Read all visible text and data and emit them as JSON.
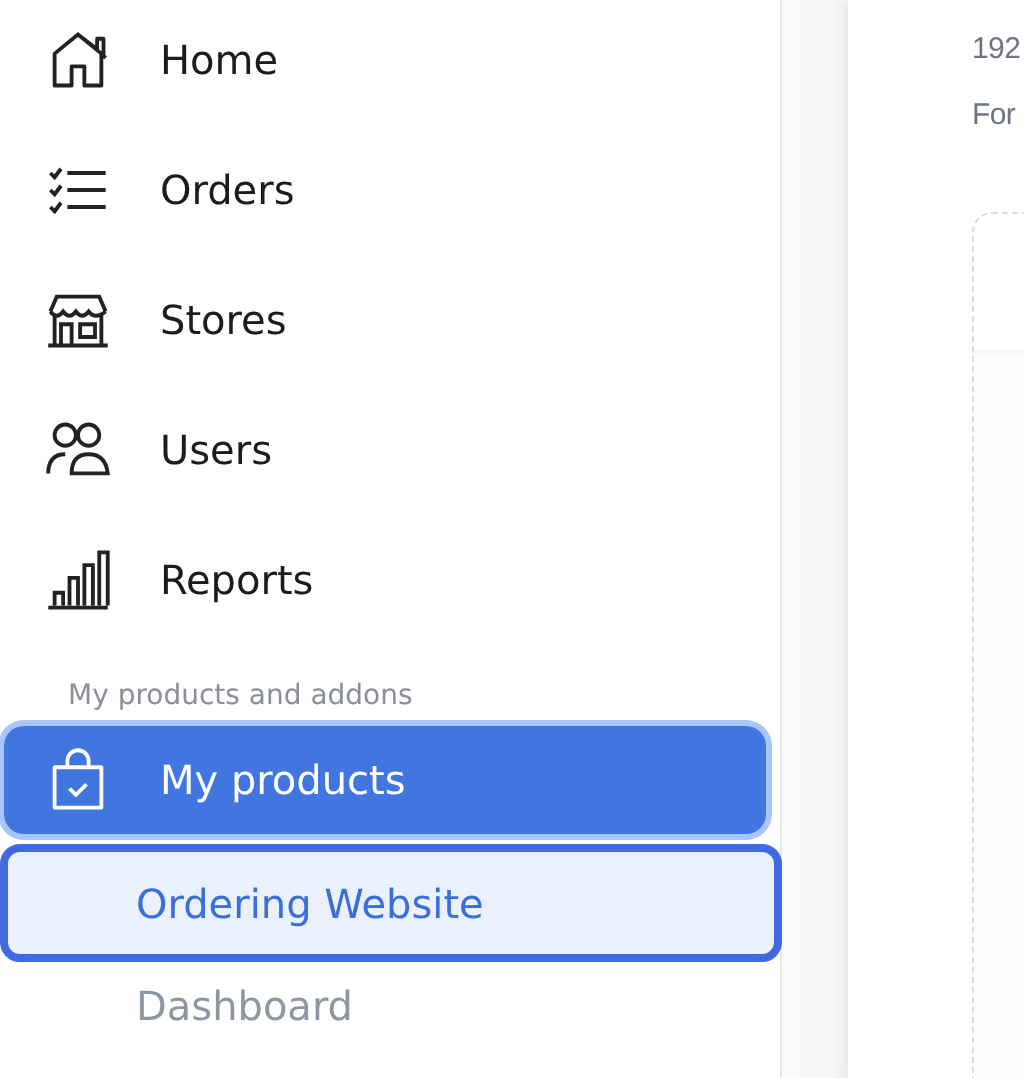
{
  "sidebar": {
    "items": [
      {
        "label": "Home",
        "selected": false
      },
      {
        "label": "Orders",
        "selected": false
      },
      {
        "label": "Stores",
        "selected": false
      },
      {
        "label": "Users",
        "selected": false
      },
      {
        "label": "Reports",
        "selected": false
      }
    ],
    "section_label": "My products and addons",
    "group": {
      "label": "My products",
      "selected": true,
      "children": [
        {
          "label": "Ordering Website",
          "selected": true
        },
        {
          "label": "Dashboard",
          "selected": false
        }
      ]
    }
  },
  "main": {
    "lines": [
      "192",
      "For"
    ]
  }
}
